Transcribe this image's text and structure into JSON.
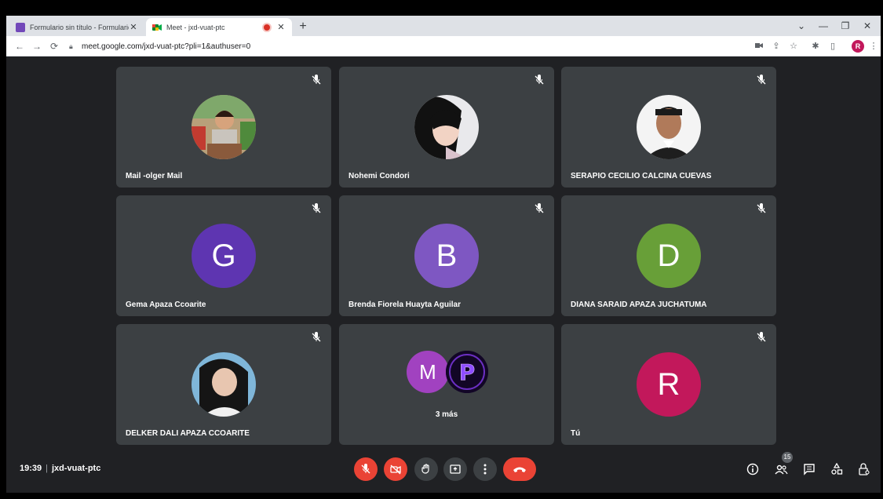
{
  "browser": {
    "tabs": [
      {
        "title": "Formulario sin título - Formulario",
        "active": false
      },
      {
        "title": "Meet - jxd-vuat-ptc",
        "active": true
      }
    ],
    "url": "meet.google.com/jxd-vuat-ptc?pli=1&authuser=0",
    "profile_initial": "R",
    "profile_color": "#c2185b"
  },
  "participants": [
    {
      "name": "Mail -olger Mail",
      "type": "photo",
      "muted": true
    },
    {
      "name": "Nohemi Condori",
      "type": "photo",
      "muted": true
    },
    {
      "name": "SERAPIO CECILIO CALCINA CUEVAS",
      "type": "photo",
      "muted": true
    },
    {
      "name": "Gema Apaza Ccoarite",
      "type": "initial",
      "initial": "G",
      "color": "#5e35b1",
      "muted": true
    },
    {
      "name": "Brenda Fiorela Huayta Aguilar",
      "type": "initial",
      "initial": "B",
      "color": "#7e57c2",
      "muted": true
    },
    {
      "name": "DIANA SARAID APAZA JUCHATUMA",
      "type": "initial",
      "initial": "D",
      "color": "#689f38",
      "muted": true
    },
    {
      "name": "DELKER DALI APAZA CCOARITE",
      "type": "photo",
      "muted": true
    },
    {
      "name": "",
      "type": "more",
      "initial_a": "M",
      "initial_b": "P",
      "label": "3 más",
      "muted": false
    },
    {
      "name": "Tú",
      "type": "initial",
      "initial": "R",
      "color": "#c2185b",
      "muted": true
    }
  ],
  "meeting": {
    "time": "19:39",
    "code": "jxd-vuat-ptc",
    "participant_count": "15"
  },
  "colors": {
    "background": "#202124",
    "tile": "#3c4043",
    "danger": "#ea4335"
  }
}
